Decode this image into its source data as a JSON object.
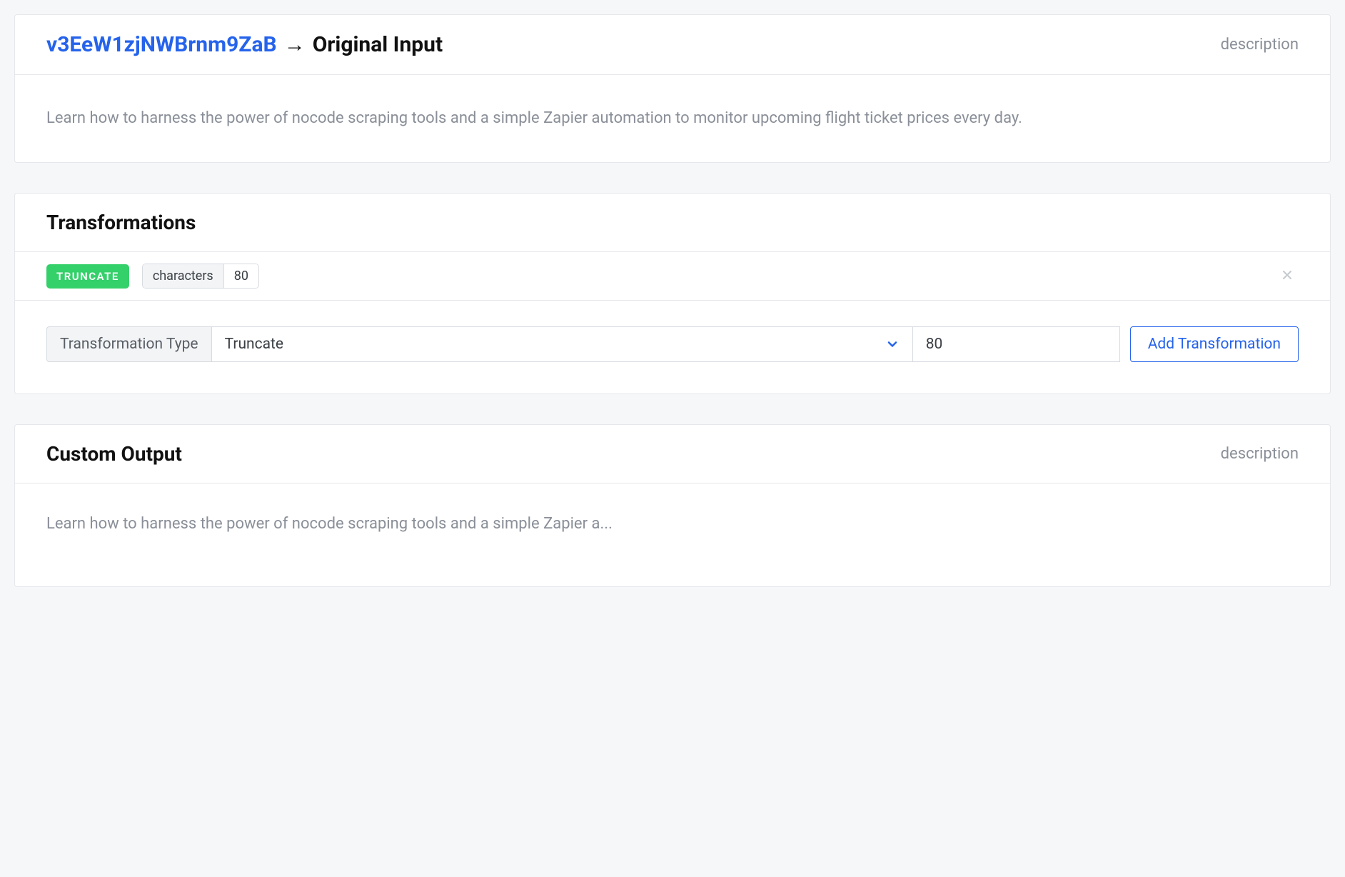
{
  "originalInput": {
    "id": "v3EeW1zjNWBrnm9ZaB",
    "titleRest": "Original Input",
    "rightLabel": "description",
    "body": "Learn how to harness the power of nocode scraping tools and a simple Zapier automation to monitor upcoming flight ticket prices every day."
  },
  "transformations": {
    "title": "Transformations",
    "applied": {
      "type": "TRUNCATE",
      "unitLabel": "characters",
      "unitValue": "80"
    },
    "form": {
      "label": "Transformation Type",
      "selected": "Truncate",
      "value": "80",
      "button": "Add Transformation"
    }
  },
  "customOutput": {
    "title": "Custom Output",
    "rightLabel": "description",
    "body": "Learn how to harness the power of nocode scraping tools and a simple Zapier a..."
  }
}
